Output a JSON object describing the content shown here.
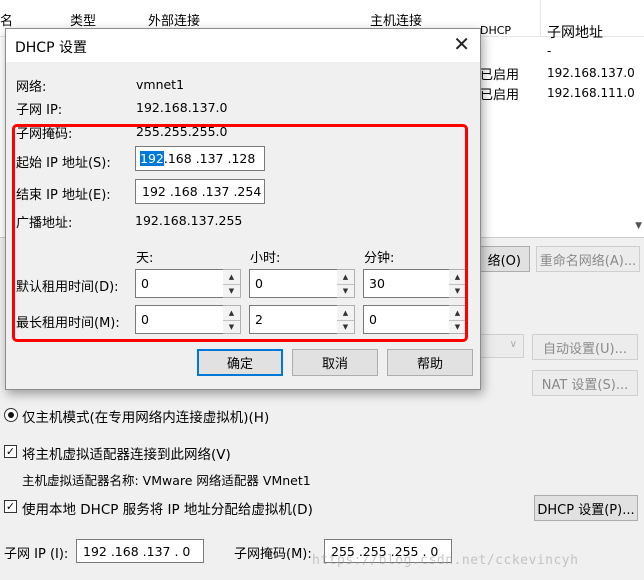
{
  "background_table": {
    "headers": [
      "名",
      "类型",
      "外部连接",
      "主机连接",
      "DHCP",
      "子网地址"
    ],
    "rows": [
      {
        "dhcp": "",
        "subnet": "-"
      },
      {
        "dhcp": "已启用",
        "subnet": "192.168.137.0"
      },
      {
        "dhcp": "已启用",
        "subnet": "192.168.111.0"
      }
    ]
  },
  "background_controls": {
    "rename_network_button": "重命名网络(A)...",
    "remove_network_button_fragment": "络(O)",
    "auto_settings_button": "自动设置(U)...",
    "nat_settings_button": "NAT 设置(S)...",
    "host_only_radio": "仅主机模式(在专用网络内连接虚拟机)(H)",
    "connect_adapter_checkbox": "将主机虚拟适配器连接到此网络(V)",
    "adapter_name_text": "主机虚拟适配器名称: VMware 网络适配器 VMnet1",
    "use_dhcp_checkbox": "使用本地 DHCP 服务将 IP 地址分配给虚拟机(D)",
    "dhcp_settings_button": "DHCP 设置(P)...",
    "subnet_ip_label": "子网 IP (I):",
    "subnet_ip_value": "192 .168 .137 .  0",
    "subnet_mask_label": "子网掩码(M):",
    "subnet_mask_value": "255 .255 .255 .  0"
  },
  "dialog": {
    "title": "DHCP 设置",
    "network_label": "网络:",
    "network_value": "vmnet1",
    "subnet_ip_label": "子网 IP:",
    "subnet_ip_value": "192.168.137.0",
    "subnet_mask_label": "子网掩码:",
    "subnet_mask_value": "255.255.255.0",
    "start_ip_label": "起始 IP 地址(S):",
    "start_ip_selected": "192",
    "start_ip_rest": " .168 .137 .128",
    "end_ip_label": "结束 IP 地址(E):",
    "end_ip_value": "192 .168 .137 .254",
    "broadcast_label": "广播地址:",
    "broadcast_value": "192.168.137.255",
    "col_days": "天:",
    "col_hours": "小时:",
    "col_minutes": "分钟:",
    "default_lease_label": "默认租用时间(D):",
    "default_lease": {
      "days": "0",
      "hours": "0",
      "minutes": "30"
    },
    "max_lease_label": "最长租用时间(M):",
    "max_lease": {
      "days": "0",
      "hours": "2",
      "minutes": "0"
    },
    "ok_button": "确定",
    "cancel_button": "取消",
    "help_button": "帮助"
  },
  "watermark": "https://blog.csdn.net/cckevincyh",
  "colors": {
    "highlight_box": "#ff0000",
    "selection": "#0078d7"
  }
}
